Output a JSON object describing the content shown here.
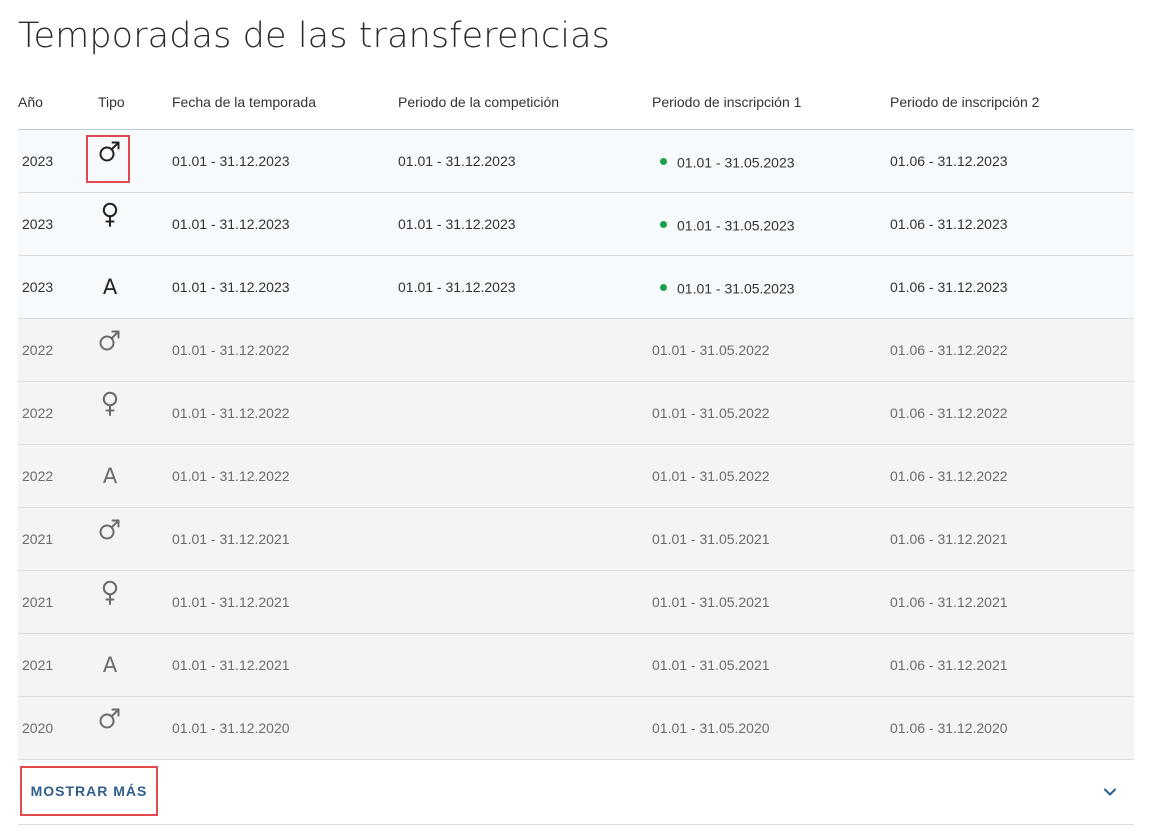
{
  "page": {
    "title": "Temporadas de las transferencias"
  },
  "colors": {
    "accent": "#2f5e8a",
    "active_dot": "#1aa14a",
    "highlight": "#e04a4f"
  },
  "table": {
    "headers": {
      "year": "Año",
      "type": "Tipo",
      "season": "Fecha de la temporada",
      "competition": "Periodo de la competición",
      "inscription1": "Periodo de inscripción 1",
      "inscription2": "Periodo de inscripción 2"
    },
    "rows": [
      {
        "year": "2023",
        "type": "male",
        "type_icon": "male-icon",
        "season": "01.01 - 31.12.2023",
        "competition": "01.01 - 31.12.2023",
        "inscription1": "01.01 - 31.05.2023",
        "inscription1_active": true,
        "inscription2": "01.06 - 31.12.2023",
        "current": true,
        "highlighted_type": true
      },
      {
        "year": "2023",
        "type": "female",
        "type_icon": "female-icon",
        "season": "01.01 - 31.12.2023",
        "competition": "01.01 - 31.12.2023",
        "inscription1": "01.01 - 31.05.2023",
        "inscription1_active": true,
        "inscription2": "01.06 - 31.12.2023",
        "current": true
      },
      {
        "year": "2023",
        "type": "all",
        "type_icon": "letter-a-icon",
        "type_label": "A",
        "season": "01.01 - 31.12.2023",
        "competition": "01.01 - 31.12.2023",
        "inscription1": "01.01 - 31.05.2023",
        "inscription1_active": true,
        "inscription2": "01.06 - 31.12.2023",
        "current": true
      },
      {
        "year": "2022",
        "type": "male",
        "type_icon": "male-icon",
        "season": "01.01 - 31.12.2022",
        "competition": "",
        "inscription1": "01.01 - 31.05.2022",
        "inscription1_active": false,
        "inscription2": "01.06 - 31.12.2022",
        "current": false
      },
      {
        "year": "2022",
        "type": "female",
        "type_icon": "female-icon",
        "season": "01.01 - 31.12.2022",
        "competition": "",
        "inscription1": "01.01 - 31.05.2022",
        "inscription1_active": false,
        "inscription2": "01.06 - 31.12.2022",
        "current": false
      },
      {
        "year": "2022",
        "type": "all",
        "type_icon": "letter-a-icon",
        "type_label": "A",
        "season": "01.01 - 31.12.2022",
        "competition": "",
        "inscription1": "01.01 - 31.05.2022",
        "inscription1_active": false,
        "inscription2": "01.06 - 31.12.2022",
        "current": false
      },
      {
        "year": "2021",
        "type": "male",
        "type_icon": "male-icon",
        "season": "01.01 - 31.12.2021",
        "competition": "",
        "inscription1": "01.01 - 31.05.2021",
        "inscription1_active": false,
        "inscription2": "01.06 - 31.12.2021",
        "current": false
      },
      {
        "year": "2021",
        "type": "female",
        "type_icon": "female-icon",
        "season": "01.01 - 31.12.2021",
        "competition": "",
        "inscription1": "01.01 - 31.05.2021",
        "inscription1_active": false,
        "inscription2": "01.06 - 31.12.2021",
        "current": false
      },
      {
        "year": "2021",
        "type": "all",
        "type_icon": "letter-a-icon",
        "type_label": "A",
        "season": "01.01 - 31.12.2021",
        "competition": "",
        "inscription1": "01.01 - 31.05.2021",
        "inscription1_active": false,
        "inscription2": "01.06 - 31.12.2021",
        "current": false
      },
      {
        "year": "2020",
        "type": "male",
        "type_icon": "male-icon",
        "season": "01.01 - 31.12.2020",
        "competition": "",
        "inscription1": "01.01 - 31.05.2020",
        "inscription1_active": false,
        "inscription2": "01.06 - 31.12.2020",
        "current": false
      }
    ]
  },
  "footer": {
    "show_more_label": "MOSTRAR MÁS",
    "expand_icon": "chevron-down-icon"
  }
}
